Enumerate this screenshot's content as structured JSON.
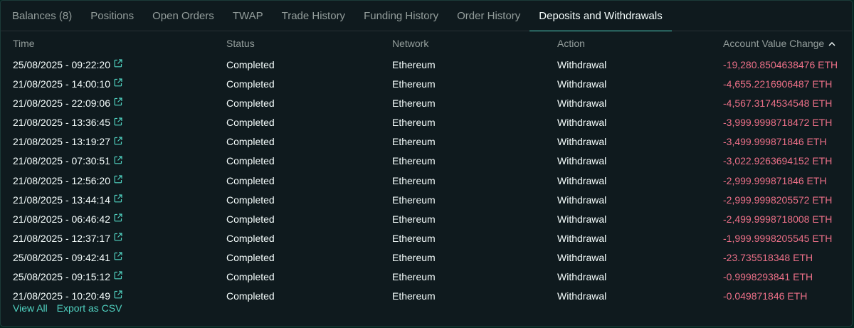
{
  "tabs": [
    {
      "label": "Balances (8)"
    },
    {
      "label": "Positions"
    },
    {
      "label": "Open Orders"
    },
    {
      "label": "TWAP"
    },
    {
      "label": "Trade History"
    },
    {
      "label": "Funding History"
    },
    {
      "label": "Order History"
    },
    {
      "label": "Deposits and Withdrawals",
      "active": true
    }
  ],
  "table": {
    "headers": {
      "time": "Time",
      "status": "Status",
      "network": "Network",
      "action": "Action",
      "change": "Account Value Change"
    },
    "sort_icon": "chevron-up-icon",
    "rows": [
      {
        "time": "25/08/2025 - 09:22:20",
        "status": "Completed",
        "network": "Ethereum",
        "action": "Withdrawal",
        "change": "-19,280.8504638476 ETH"
      },
      {
        "time": "21/08/2025 - 14:00:10",
        "status": "Completed",
        "network": "Ethereum",
        "action": "Withdrawal",
        "change": "-4,655.2216906487 ETH"
      },
      {
        "time": "21/08/2025 - 22:09:06",
        "status": "Completed",
        "network": "Ethereum",
        "action": "Withdrawal",
        "change": "-4,567.3174534548 ETH"
      },
      {
        "time": "21/08/2025 - 13:36:45",
        "status": "Completed",
        "network": "Ethereum",
        "action": "Withdrawal",
        "change": "-3,999.9998718472 ETH"
      },
      {
        "time": "21/08/2025 - 13:19:27",
        "status": "Completed",
        "network": "Ethereum",
        "action": "Withdrawal",
        "change": "-3,499.999871846 ETH"
      },
      {
        "time": "21/08/2025 - 07:30:51",
        "status": "Completed",
        "network": "Ethereum",
        "action": "Withdrawal",
        "change": "-3,022.9263694152 ETH"
      },
      {
        "time": "21/08/2025 - 12:56:20",
        "status": "Completed",
        "network": "Ethereum",
        "action": "Withdrawal",
        "change": "-2,999.999871846 ETH"
      },
      {
        "time": "21/08/2025 - 13:44:14",
        "status": "Completed",
        "network": "Ethereum",
        "action": "Withdrawal",
        "change": "-2,999.9998205572 ETH"
      },
      {
        "time": "21/08/2025 - 06:46:42",
        "status": "Completed",
        "network": "Ethereum",
        "action": "Withdrawal",
        "change": "-2,499.9998718008 ETH"
      },
      {
        "time": "21/08/2025 - 12:37:17",
        "status": "Completed",
        "network": "Ethereum",
        "action": "Withdrawal",
        "change": "-1,999.9998205545 ETH"
      },
      {
        "time": "25/08/2025 - 09:42:41",
        "status": "Completed",
        "network": "Ethereum",
        "action": "Withdrawal",
        "change": "-23.735518348 ETH"
      },
      {
        "time": "25/08/2025 - 09:15:12",
        "status": "Completed",
        "network": "Ethereum",
        "action": "Withdrawal",
        "change": "-0.9998293841 ETH"
      },
      {
        "time": "21/08/2025 - 10:20:49",
        "status": "Completed",
        "network": "Ethereum",
        "action": "Withdrawal",
        "change": "-0.049871846 ETH"
      }
    ],
    "row_link_icon": "external-link-icon"
  },
  "footer": {
    "view_all": "View All",
    "export": "Export as CSV"
  },
  "colors": {
    "accent": "#50d2c1",
    "negative": "#ed7088",
    "text": "#f6fefd",
    "muted": "#949e9c",
    "panel": "#0f1a1e"
  }
}
